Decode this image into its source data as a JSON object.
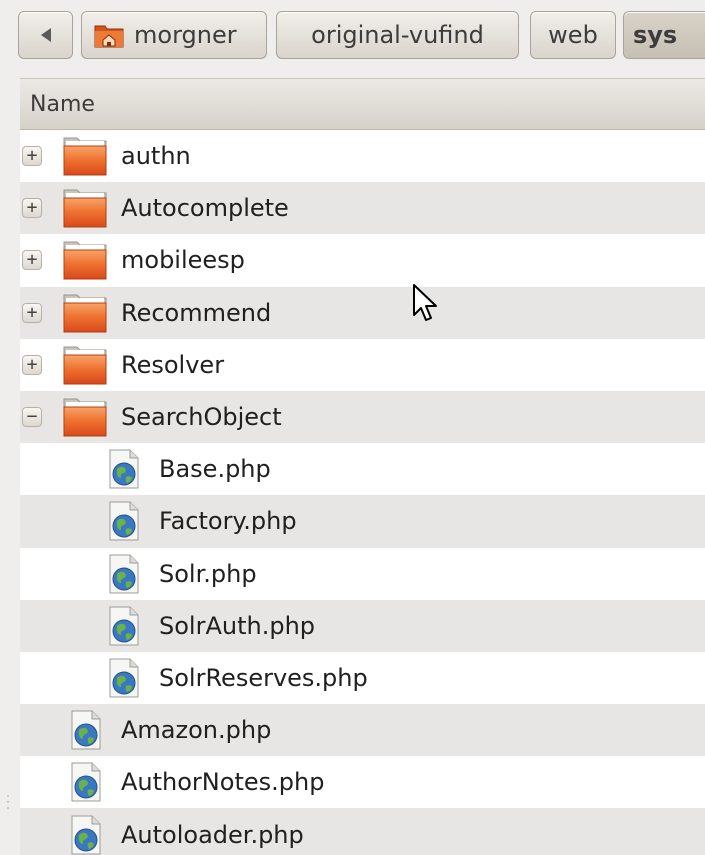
{
  "pathbar": {
    "back_icon": "left-triangle-icon",
    "crumbs": [
      {
        "label": "morgner",
        "icon": "home-folder-icon"
      },
      {
        "label": "original-vufind"
      },
      {
        "label": "web"
      },
      {
        "label": "sys"
      }
    ]
  },
  "listview": {
    "column_header": "Name",
    "rows": [
      {
        "label": "authn",
        "type": "folder",
        "expander": "+",
        "depth": 0
      },
      {
        "label": "Autocomplete",
        "type": "folder",
        "expander": "+",
        "depth": 0
      },
      {
        "label": "mobileesp",
        "type": "folder",
        "expander": "+",
        "depth": 0
      },
      {
        "label": "Recommend",
        "type": "folder",
        "expander": "+",
        "depth": 0
      },
      {
        "label": "Resolver",
        "type": "folder",
        "expander": "+",
        "depth": 0
      },
      {
        "label": "SearchObject",
        "type": "folder",
        "expander": "−",
        "depth": 0
      },
      {
        "label": "Base.php",
        "type": "php",
        "depth": 1
      },
      {
        "label": "Factory.php",
        "type": "php",
        "depth": 1
      },
      {
        "label": "Solr.php",
        "type": "php",
        "depth": 1
      },
      {
        "label": "SolrAuth.php",
        "type": "php",
        "depth": 1
      },
      {
        "label": "SolrReserves.php",
        "type": "php",
        "depth": 1
      },
      {
        "label": "Amazon.php",
        "type": "php",
        "depth": 0
      },
      {
        "label": "AuthorNotes.php",
        "type": "php",
        "depth": 0
      },
      {
        "label": "Autoloader.php",
        "type": "php",
        "depth": 0
      }
    ]
  },
  "colors": {
    "folder_orange": "#e65a1c",
    "selected_crumb": "#cfc8bd",
    "row_alt": "#e7e6e4"
  }
}
